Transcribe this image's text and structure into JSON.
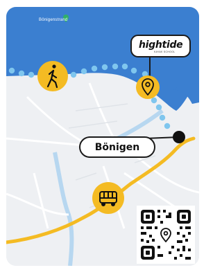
{
  "map": {
    "lake_label": "Bönigenstrand",
    "colors": {
      "lake": "#3b7fd0",
      "land": "#eef0f3",
      "route_walk": "#7fc6ee",
      "route_drive": "#f4bb23",
      "marker": "#f4bb23"
    }
  },
  "logo": {
    "name": "hightide",
    "tagline": "KAYAK SCHOOL"
  },
  "place": {
    "name": "Bönigen"
  },
  "icons": {
    "walk": "walking-person-icon",
    "pin": "location-pin-icon",
    "bus": "bus-icon",
    "qr": "qr-code-icon"
  }
}
